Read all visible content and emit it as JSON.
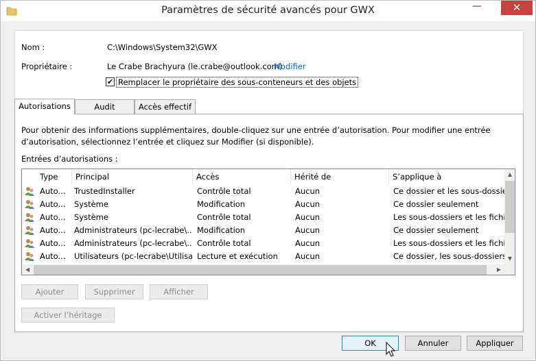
{
  "window": {
    "title": "Paramètres de sécurité avancés pour GWX",
    "close_symbol": "✕",
    "minimize_symbol": "—"
  },
  "info": {
    "name_label": "Nom :",
    "name_value": "C:\\Windows\\System32\\GWX",
    "owner_label": "Propriétaire :",
    "owner_value": "Le Crabe Brachyura (le.crabe@outlook.com)",
    "owner_change_link": "Modifier",
    "replace_owner_checked": true,
    "replace_owner_label": "Remplacer le propriétaire des sous-conteneurs et des objets",
    "check_symbol": "✔"
  },
  "tabs": [
    {
      "label": "Autorisations",
      "active": true
    },
    {
      "label": "Audit",
      "active": false
    },
    {
      "label": "Accès effectif",
      "active": false
    }
  ],
  "permissions": {
    "instructions": "Pour obtenir des informations supplémentaires, double-cliquez sur une entrée d’autorisation. Pour modifier une entrée d’autorisation, sélectionnez l’entrée et cliquez sur Modifier (si disponible).",
    "entries_label": "Entrées d’autorisations :",
    "columns": [
      "Type",
      "Principal",
      "Accès",
      "Hérité de",
      "S’applique à"
    ],
    "rows": [
      [
        "Auto...",
        "TrustedInstaller",
        "Contrôle total",
        "Aucun",
        "Ce dossier et les sous-dossiers"
      ],
      [
        "Auto...",
        "Système",
        "Modification",
        "Aucun",
        "Ce dossier seulement"
      ],
      [
        "Auto...",
        "Système",
        "Contrôle total",
        "Aucun",
        "Les sous-dossiers et les fichiers"
      ],
      [
        "Auto...",
        "Administrateurs (pc-lecrabe\\...",
        "Modification",
        "Aucun",
        "Ce dossier seulement"
      ],
      [
        "Auto...",
        "Administrateurs (pc-lecrabe\\...",
        "Contrôle total",
        "Aucun",
        "Les sous-dossiers et les fichiers"
      ],
      [
        "Auto...",
        "Utilisateurs (pc-lecrabe\\Utilisa...",
        "Lecture et exécution",
        "Aucun",
        "Ce dossier, les sous-dossiers e..."
      ]
    ],
    "icon": "users-icon",
    "scroll_up": "▲",
    "scroll_down": "▼",
    "scroll_left": "◀",
    "scroll_right": "▶"
  },
  "actions": {
    "add": "Ajouter",
    "remove": "Supprimer",
    "view": "Afficher",
    "enable_inheritance": "Activer l’héritage"
  },
  "footer": {
    "ok": "OK",
    "cancel": "Annuler",
    "apply": "Appliquer"
  }
}
